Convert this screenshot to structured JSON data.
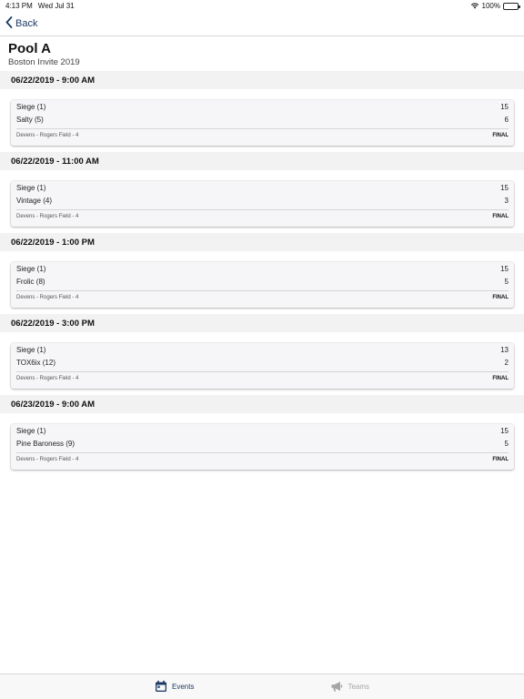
{
  "status_bar": {
    "time": "4:13 PM",
    "date": "Wed Jul 31",
    "battery": "100%",
    "battery_level": 1.0
  },
  "nav": {
    "back_label": "Back"
  },
  "header": {
    "title": "Pool A",
    "subtitle": "Boston Invite 2019"
  },
  "colors": {
    "accent": "#1d3a63",
    "inactive": "#a5a5a5",
    "section_bg": "#f2f2f2"
  },
  "games": [
    {
      "datetime": "06/22/2019 - 9:00 AM",
      "team1": "Siege (1)",
      "score1": "15",
      "team2": "Salty (5)",
      "score2": "6",
      "field": "Devens - Rogers Field - 4",
      "status": "FINAL"
    },
    {
      "datetime": "06/22/2019 - 11:00 AM",
      "team1": "Siege (1)",
      "score1": "15",
      "team2": "Vintage (4)",
      "score2": "3",
      "field": "Devens - Rogers Field - 4",
      "status": "FINAL"
    },
    {
      "datetime": "06/22/2019 - 1:00 PM",
      "team1": "Siege (1)",
      "score1": "15",
      "team2": "Frolic (8)",
      "score2": "5",
      "field": "Devens - Rogers Field - 4",
      "status": "FINAL"
    },
    {
      "datetime": "06/22/2019 - 3:00 PM",
      "team1": "Siege (1)",
      "score1": "13",
      "team2": "TOX6ix (12)",
      "score2": "2",
      "field": "Devens - Rogers Field - 4",
      "status": "FINAL"
    },
    {
      "datetime": "06/23/2019 - 9:00 AM",
      "team1": "Siege (1)",
      "score1": "15",
      "team2": "Pine Baroness (9)",
      "score2": "5",
      "field": "Devens - Rogers Field - 4",
      "status": "FINAL"
    }
  ],
  "tab_bar": {
    "events": {
      "label": "Events",
      "icon": "calendar-icon",
      "active": true
    },
    "teams": {
      "label": "Teams",
      "icon": "megaphone-icon",
      "active": false
    }
  }
}
